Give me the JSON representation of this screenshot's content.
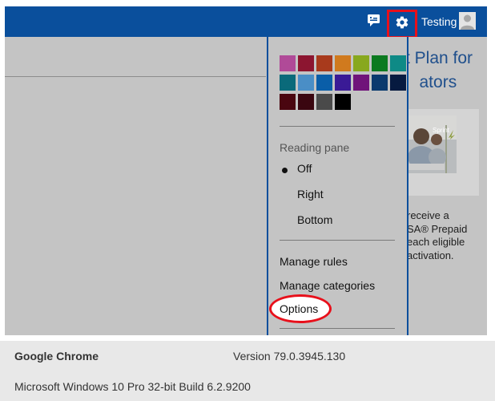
{
  "topbar": {
    "user_name": "Testing",
    "icons": [
      "chat-icon",
      "gear-icon",
      "avatar-icon"
    ]
  },
  "promo": {
    "heading": "t Plan for\n   ators",
    "image_caption": "Sprint",
    "body": "receive a\nSA® Prepaid\neach eligible\nactivation."
  },
  "settings_menu": {
    "theme_colors": [
      "#b04a98",
      "#8c1530",
      "#a83a1c",
      "#d07a1e",
      "#88a81e",
      "#0c7a20",
      "#0e8a86",
      "#0a6a7a",
      "#4a8ec6",
      "#0a5ea8",
      "#3a1a96",
      "#70147a",
      "#0a3a6e",
      "#061a40",
      "#4a0610",
      "#3a0610",
      "#4a4a4a",
      "#000000"
    ],
    "reading_pane_label": "Reading pane",
    "reading_pane_options": [
      "Off",
      "Right",
      "Bottom"
    ],
    "reading_pane_selected": "Off",
    "manage_rules": "Manage rules",
    "manage_categories": "Manage categories",
    "options": "Options"
  },
  "footer": {
    "browser_name": "Google Chrome",
    "browser_version": "Version 79.0.3945.130",
    "os_info": "Microsoft Windows 10 Pro 32-bit Build 6.2.9200"
  },
  "colors": {
    "brand_blue": "#0a4f9c",
    "highlight_red": "#e8101b",
    "overlay_gray": "#c4c4c4"
  }
}
